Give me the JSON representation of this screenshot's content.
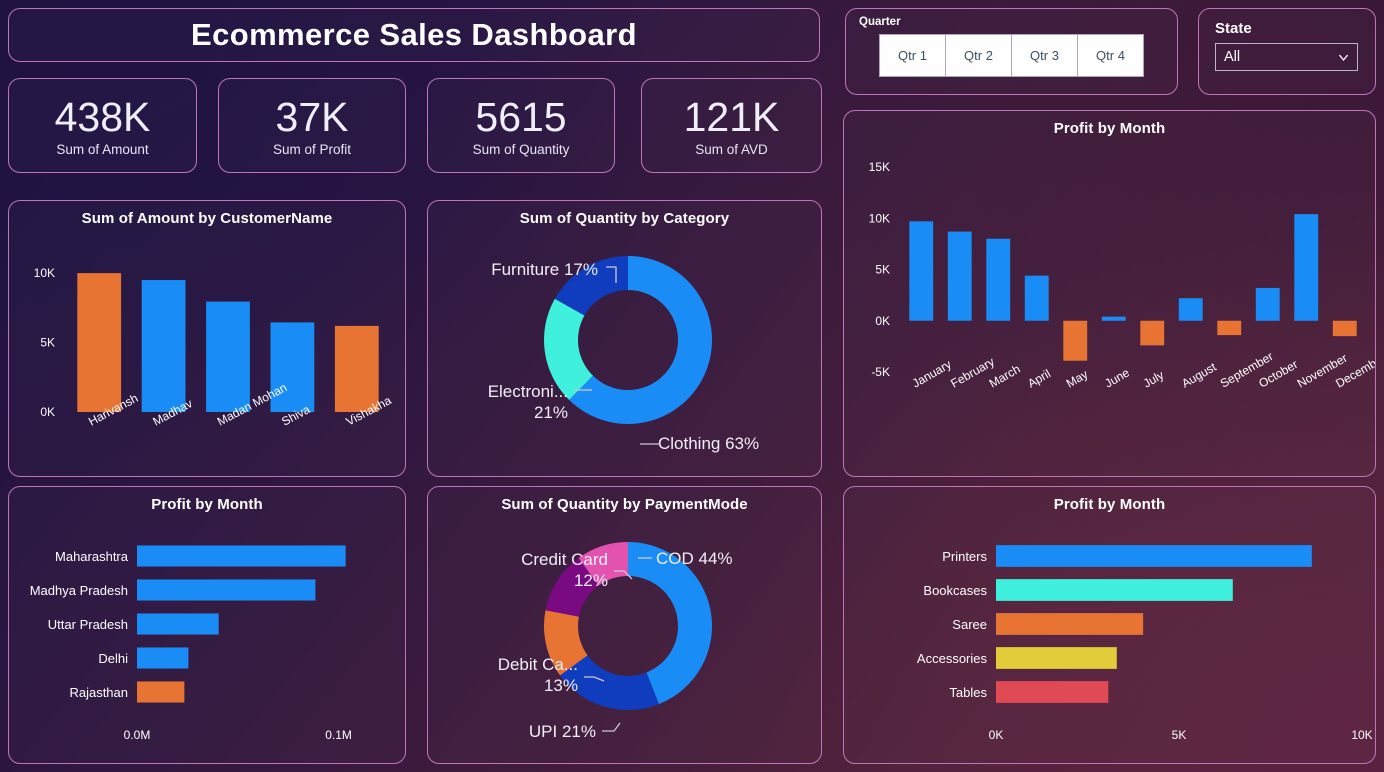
{
  "header": {
    "title": "Ecommerce Sales Dashboard"
  },
  "kpis": [
    {
      "value": "438K",
      "label": "Sum of Amount"
    },
    {
      "value": "37K",
      "label": "Sum of Profit"
    },
    {
      "value": "5615",
      "label": "Sum of Quantity"
    },
    {
      "value": "121K",
      "label": "Sum of AVD"
    }
  ],
  "quarter_slicer": {
    "label": "Quarter",
    "options": [
      "Qtr 1",
      "Qtr 2",
      "Qtr 3",
      "Qtr 4"
    ]
  },
  "state_slicer": {
    "label": "State",
    "selected": "All",
    "icon": "chevron-down-icon"
  },
  "colors": {
    "accent_blue": "#1a8cf5",
    "orange": "#e87434",
    "cyan": "#3ff0dc",
    "dark_blue": "#0f43c4",
    "purple": "#7a0a82",
    "pink": "#e452b0",
    "yellow": "#e2cc3a",
    "red": "#e04a55",
    "border": "#c075b8"
  },
  "chart_data": [
    {
      "id": "customer_amount",
      "type": "bar",
      "title": "Sum of Amount by CustomerName",
      "xlabel": "",
      "ylabel": "",
      "categories": [
        "Harivansh",
        "Madhav",
        "Madan Mohan",
        "Shiva",
        "Vishakha"
      ],
      "values": [
        10000,
        9500,
        7950,
        6450,
        6200
      ],
      "colors": [
        "#e87434",
        "#1a8cf5",
        "#1a8cf5",
        "#1a8cf5",
        "#e87434"
      ],
      "ylim": [
        0,
        10800
      ],
      "yticks": [
        0,
        5000,
        10000
      ],
      "ytick_labels": [
        "0K",
        "5K",
        "10K"
      ],
      "grid": false
    },
    {
      "id": "category_quantity",
      "type": "pie",
      "title": "Sum of Quantity by Category",
      "labels": [
        "Clothing",
        "Electroni...",
        "Furniture"
      ],
      "percent_labels": [
        "Clothing 63%",
        "Electroni... 21%",
        "Furniture 17%"
      ],
      "values": [
        63,
        21,
        17
      ],
      "colors": [
        "#1a8cf5",
        "#3ff0dc",
        "#0f3dbe"
      ],
      "donut": true,
      "legend": "callout-labels"
    },
    {
      "id": "profit_by_month_columns",
      "type": "bar",
      "title": "Profit by Month",
      "xlabel": "",
      "ylabel": "",
      "categories": [
        "January",
        "February",
        "March",
        "April",
        "May",
        "June",
        "July",
        "August",
        "September",
        "October",
        "November",
        "December"
      ],
      "values": [
        9700,
        8700,
        8000,
        4400,
        -3900,
        400,
        -2400,
        2200,
        -1400,
        3200,
        10400,
        -1500
      ],
      "positive_color": "#1a8cf5",
      "negative_color": "#e87434",
      "ylim": [
        -5000,
        15000
      ],
      "yticks": [
        -5000,
        0,
        5000,
        10000,
        15000
      ],
      "ytick_labels": [
        "-5K",
        "0K",
        "5K",
        "10K",
        "15K"
      ],
      "grid": false
    },
    {
      "id": "profit_by_state",
      "type": "bar",
      "orientation": "horizontal",
      "title": "Profit by Month",
      "xlabel": "",
      "ylabel": "",
      "categories": [
        "Maharashtra",
        "Madhya Pradesh",
        "Uttar Pradesh",
        "Delhi",
        "Rajasthan"
      ],
      "values": [
        0.1035,
        0.0885,
        0.0405,
        0.0255,
        0.0235
      ],
      "colors": [
        "#1a8cf5",
        "#1a8cf5",
        "#1a8cf5",
        "#1a8cf5",
        "#e87434"
      ],
      "xlim": [
        0,
        0.125
      ],
      "xticks": [
        0,
        0.1
      ],
      "xtick_labels": [
        "0.0M",
        "0.1M"
      ],
      "grid": false
    },
    {
      "id": "paymentmode_quantity",
      "type": "pie",
      "title": "Sum of Quantity by PaymentMode",
      "labels": [
        "COD",
        "UPI",
        "Debit Ca...",
        "Credit Card",
        ""
      ],
      "percent_labels": [
        "COD 44%",
        "UPI 21%",
        "Debit Ca... 13%",
        "Credit Card 12%",
        ""
      ],
      "values": [
        44,
        21,
        13,
        12,
        10
      ],
      "colors": [
        "#1a8cf5",
        "#0f3dbe",
        "#e87434",
        "#7a0a82",
        "#e452b0"
      ],
      "donut": true,
      "legend": "callout-labels"
    },
    {
      "id": "profit_by_product",
      "type": "bar",
      "orientation": "horizontal",
      "title": "Profit by Month",
      "xlabel": "",
      "ylabel": "",
      "categories": [
        "Printers",
        "Bookcases",
        "Saree",
        "Accessories",
        "Tables"
      ],
      "values": [
        8630,
        6470,
        4020,
        3300,
        3070
      ],
      "colors": [
        "#1a8cf5",
        "#3ff0dc",
        "#e87434",
        "#e2cc3a",
        "#e04a55"
      ],
      "xlim": [
        0,
        10000
      ],
      "xticks": [
        0,
        5000,
        10000
      ],
      "xtick_labels": [
        "0K",
        "5K",
        "10K"
      ],
      "grid": false
    }
  ]
}
